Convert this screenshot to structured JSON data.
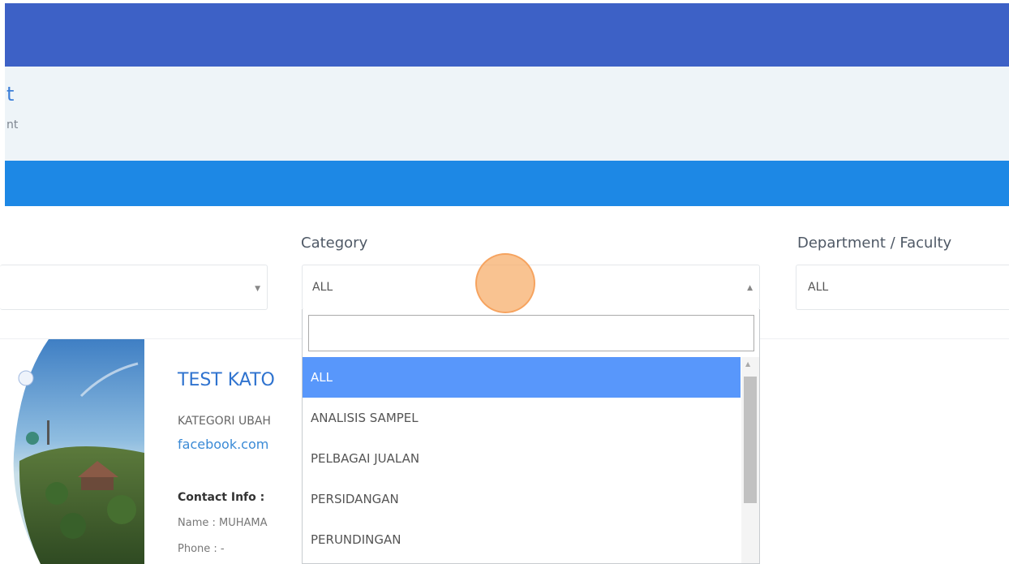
{
  "header": {
    "title": "t",
    "subtitle": "nt"
  },
  "filters": {
    "category_label": "Category",
    "category_value": "ALL",
    "department_label": "Department / Faculty",
    "department_value": "ALL",
    "search_placeholder": ""
  },
  "dropdown": {
    "options": [
      "ALL",
      "ANALISIS SAMPEL",
      "PELBAGAI JUALAN",
      "PERSIDANGAN",
      "PERUNDINGAN"
    ],
    "selected_index": 0
  },
  "card": {
    "title": "TEST KATO",
    "category": "KATEGORI UBAH",
    "link": "facebook.com",
    "contact_label": "Contact Info :",
    "name": "Name : MUHAMA",
    "phone": "Phone : -"
  },
  "colors": {
    "topbar": "#3d61c6",
    "nav_band": "#1d88e5",
    "header_band": "#eef4f8",
    "selected_option": "#5897fb",
    "link": "#3a8ad6"
  },
  "icons": {
    "caret_down": "caret-down-icon",
    "caret_up": "caret-up-icon"
  }
}
